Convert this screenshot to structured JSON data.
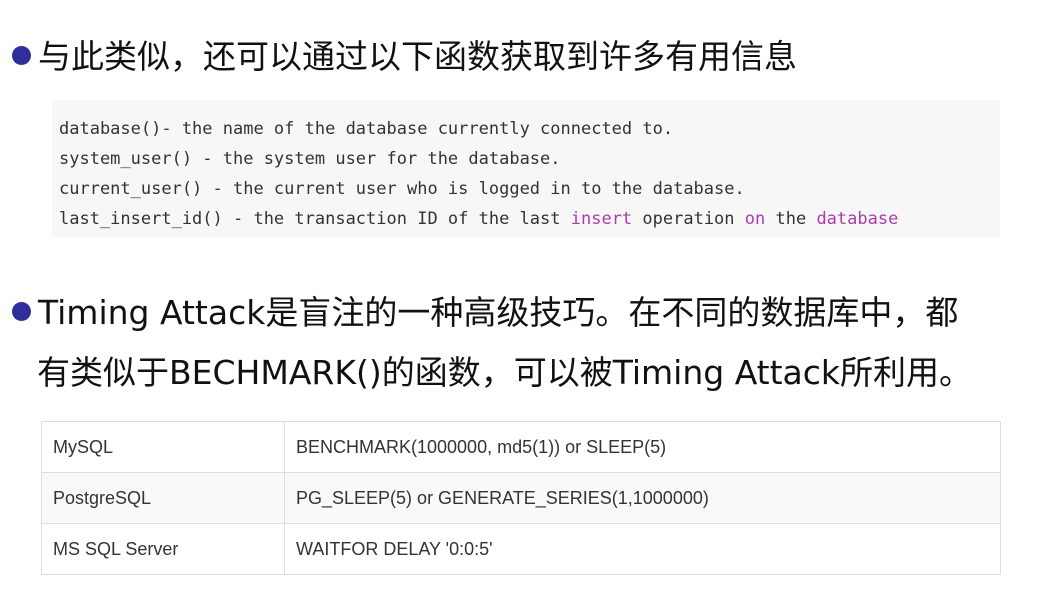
{
  "bullet1": {
    "text": "与此类似，还可以通过以下函数获取到许多有用信息"
  },
  "code": {
    "lines": [
      {
        "segments": [
          {
            "text": "database()- the name of the database currently connected to.",
            "kw": false
          }
        ]
      },
      {
        "segments": [
          {
            "text": "system_user() - the system user for the database.",
            "kw": false
          }
        ]
      },
      {
        "segments": [
          {
            "text": "current_user() - the current user who is logged in to the database.",
            "kw": false
          }
        ]
      },
      {
        "segments": [
          {
            "text": "last_insert_id() - the transaction ID of the last ",
            "kw": false
          },
          {
            "text": "insert",
            "kw": true
          },
          {
            "text": " operation ",
            "kw": false
          },
          {
            "text": "on",
            "kw": true
          },
          {
            "text": " the ",
            "kw": false
          },
          {
            "text": "database",
            "kw": true
          }
        ]
      }
    ],
    "keyword_color": "#a93dab"
  },
  "bullet2": {
    "line1": "Timing  Attack是盲注的一种高级技巧。在不同的数据库中，都",
    "line2": "有类似于BECHMARK()的函数，可以被Timing Attack所利用。"
  },
  "table": {
    "rows": [
      {
        "db": "MySQL",
        "func": "BENCHMARK(1000000,  md5(1)) or SLEEP(5)"
      },
      {
        "db": "PostgreSQL",
        "func": "PG_SLEEP(5) or GENERATE_SERIES(1,1000000)"
      },
      {
        "db": "MS SQL Server",
        "func": "WAITFOR DELAY '0:0:5'"
      }
    ]
  },
  "colors": {
    "bullet": "#2f2f9a",
    "code_bg": "#f7f7f7",
    "table_border": "#dddddd"
  }
}
